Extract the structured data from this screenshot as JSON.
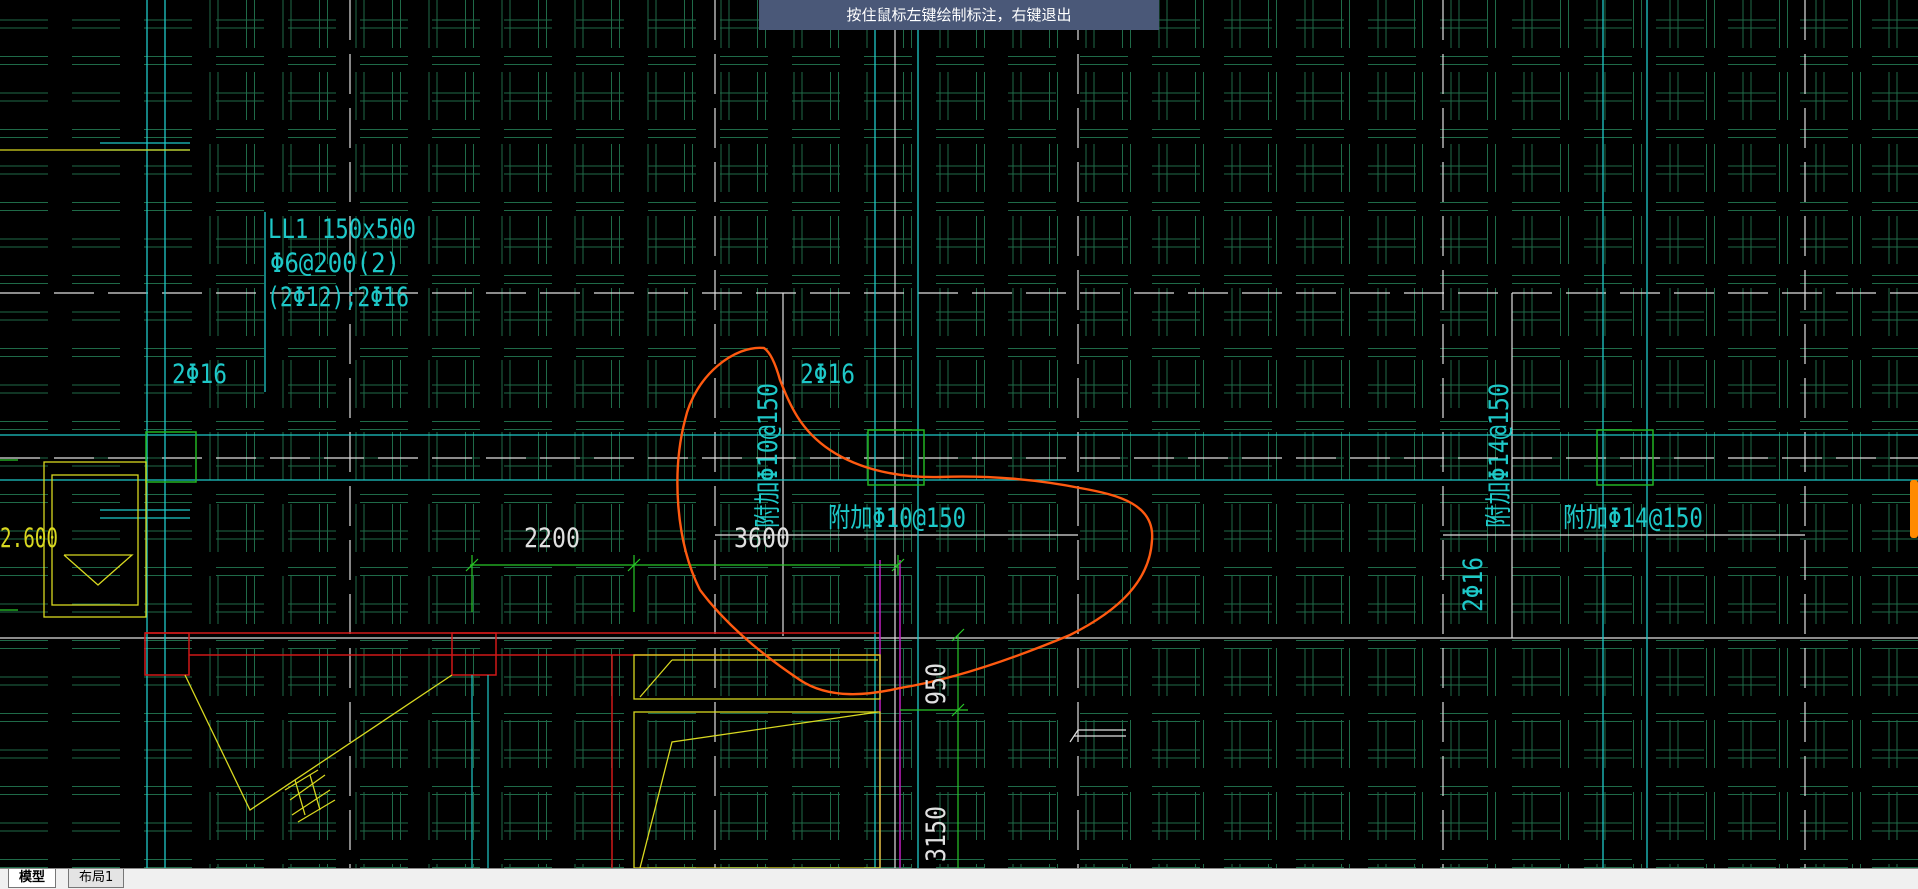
{
  "hint_text": "按住鼠标左键绘制标注，右键退出",
  "tabs": {
    "model": "模型",
    "layout1": "布局1"
  },
  "annotations": {
    "beam_line1": "LL1 150x500",
    "beam_line2": "Φ6@200(2)",
    "beam_line3": "(2Φ12);2Φ16",
    "rebar_left": "2Φ16",
    "rebar_mid": "2Φ16",
    "rebar_right_vertical": "2Φ16",
    "addl_mid_vertical": "附加Φ10@150",
    "addl_mid_horizontal": "附加Φ10@150",
    "addl_right_vertical": "附加Φ14@150",
    "addl_right_horizontal": "附加Φ14@150",
    "elevation": "2.600",
    "dim_2200": "2200",
    "dim_3600": "3600",
    "dim_950": "950",
    "dim_3150": "3150"
  },
  "colors": {
    "background": "#000000",
    "grid_green": "#1f6a48",
    "axis_white": "#e0e0e0",
    "beam_cyan": "#1ec8c8",
    "column_green": "#22b422",
    "wall_red": "#d01818",
    "stair_yellow": "#d8d820",
    "dim_green": "#28c828",
    "magenta": "#c020c0",
    "markup_orange": "#ff5a10",
    "hint_bg": "#4a5878"
  }
}
